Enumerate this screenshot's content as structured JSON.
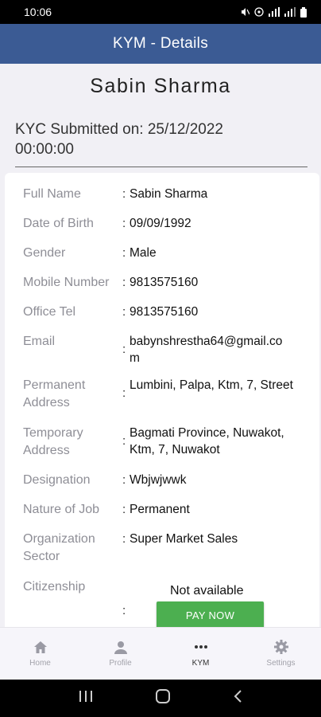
{
  "status_bar": {
    "time": "10:06"
  },
  "app_bar": {
    "title": "KYM - Details"
  },
  "profile": {
    "name": "Sabin Sharma",
    "kyc_submitted": "KYC Submitted on: 25/12/2022 00:00:00"
  },
  "details": [
    {
      "label": "Full Name",
      "value": "Sabin Sharma"
    },
    {
      "label": "Date of Birth",
      "value": "09/09/1992"
    },
    {
      "label": "Gender",
      "value": "Male"
    },
    {
      "label": "Mobile Number",
      "value": "9813575160"
    },
    {
      "label": "Office Tel",
      "value": "9813575160"
    },
    {
      "label": "Email",
      "value": "babynshrestha64@gmail.com"
    },
    {
      "label": "Permanent Address",
      "value": "Lumbini, Palpa, Ktm, 7, Street"
    },
    {
      "label": "Temporary Address",
      "value": "Bagmati Province, Nuwakot, Ktm, 7, Nuwakot"
    },
    {
      "label": "Designation",
      "value": "Wbjwjwwk"
    },
    {
      "label": "Nature of Job",
      "value": "Permanent"
    },
    {
      "label": "Organization Sector",
      "value": "Super Market Sales"
    }
  ],
  "citizenship": {
    "label": "Citizenship",
    "value": "Not available",
    "button": "PAY NOW"
  },
  "colon": ":",
  "bottom_nav": [
    {
      "label": "Home",
      "icon": "home-icon"
    },
    {
      "label": "Profile",
      "icon": "person-icon"
    },
    {
      "label": "KYM",
      "icon": "more-dots-icon",
      "active": true
    },
    {
      "label": "Settings",
      "icon": "gear-icon"
    }
  ],
  "colors": {
    "app_bar": "#3b5b94",
    "pay_button": "#4caf50",
    "label": "#8e8e96",
    "background": "#f1f0f5"
  }
}
